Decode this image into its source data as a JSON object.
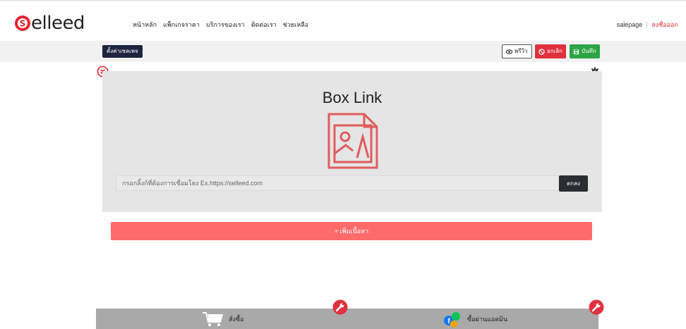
{
  "brand": {
    "name": "elleed",
    "logo_letter": "S",
    "accent": "#e8232f"
  },
  "nav": {
    "links": [
      "หน้าหลัก",
      "แพ็กเกจราคา",
      "บริการของเรา",
      "ติดต่อเรา",
      "ช่วยเหลือ"
    ],
    "username": "salepage",
    "logout": "ลงชื่อออก"
  },
  "toolbar": {
    "settings_label": "ตั้งค่าเซลเพจ",
    "preview_label": "พรีวิว",
    "cancel_label": "ยกเลิก",
    "save_label": "บันทึก"
  },
  "box": {
    "title": "Box Link",
    "link_placeholder": "กรอกลิ้งก์ที่ต้องการเชื่อมโยง Ex.https://selleed.com",
    "ok_label": "ตกลง"
  },
  "add_content_label": "+ เพิ่มเนื้อหา",
  "bottom_bar": {
    "items": [
      {
        "label": "สั่งซื้อ",
        "icon": "cart-icon"
      },
      {
        "label": "ซื้อผ่านแอดมิน",
        "icon": "chat-apps-icon"
      }
    ]
  },
  "colors": {
    "toolbar_dark": "#1d2440",
    "cancel": "#e0303e",
    "save": "#2ca445",
    "add_button": "#ff6b6b",
    "image_placeholder": "#e05c5c",
    "bottom_bar": "#a9a9aa"
  }
}
